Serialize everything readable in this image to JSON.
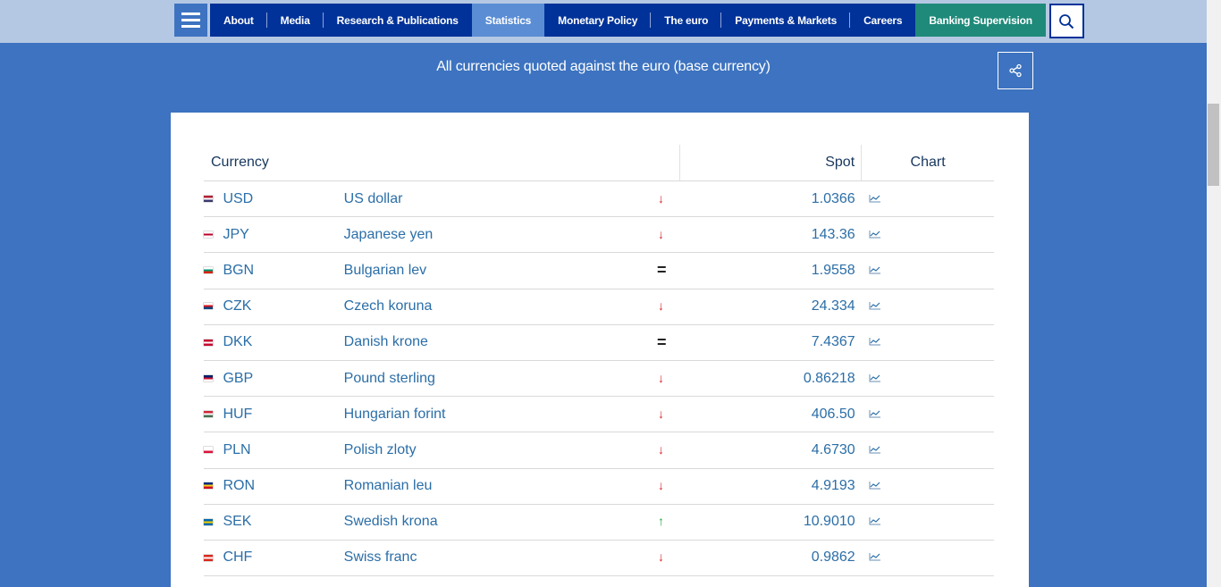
{
  "nav": {
    "items": [
      {
        "label": "About",
        "state": "normal"
      },
      {
        "label": "Media",
        "state": "normal"
      },
      {
        "label": "Research & Publications",
        "state": "normal"
      },
      {
        "label": "Statistics",
        "state": "active"
      },
      {
        "label": "Monetary Policy",
        "state": "normal"
      },
      {
        "label": "The euro",
        "state": "normal"
      },
      {
        "label": "Payments & Markets",
        "state": "normal"
      },
      {
        "label": "Careers",
        "state": "normal"
      },
      {
        "label": "Banking Supervision",
        "state": "highlight"
      }
    ]
  },
  "header": {
    "subtitle": "All currencies quoted against the euro (base currency)"
  },
  "table": {
    "columns": {
      "currency": "Currency",
      "spot": "Spot",
      "chart": "Chart"
    },
    "rows": [
      {
        "code": "USD",
        "name": "US dollar",
        "trend": "down",
        "spot": "1.0366",
        "flag": [
          "#b22234",
          "#ffffff",
          "#3c3b6e"
        ]
      },
      {
        "code": "JPY",
        "name": "Japanese yen",
        "trend": "down",
        "spot": "143.36",
        "flag": [
          "#ffffff",
          "#bc002d",
          "#ffffff"
        ]
      },
      {
        "code": "BGN",
        "name": "Bulgarian lev",
        "trend": "equal",
        "spot": "1.9558",
        "flag": [
          "#ffffff",
          "#00966e",
          "#d62612"
        ]
      },
      {
        "code": "CZK",
        "name": "Czech koruna",
        "trend": "down",
        "spot": "24.334",
        "flag": [
          "#ffffff",
          "#d7141a",
          "#11457e"
        ]
      },
      {
        "code": "DKK",
        "name": "Danish krone",
        "trend": "equal",
        "spot": "7.4367",
        "flag": [
          "#c60c30",
          "#ffffff",
          "#c60c30"
        ]
      },
      {
        "code": "GBP",
        "name": "Pound sterling",
        "trend": "down",
        "spot": "0.86218",
        "flag": [
          "#012169",
          "#c8102e",
          "#ffffff"
        ]
      },
      {
        "code": "HUF",
        "name": "Hungarian forint",
        "trend": "down",
        "spot": "406.50",
        "flag": [
          "#ce2939",
          "#ffffff",
          "#477050"
        ]
      },
      {
        "code": "PLN",
        "name": "Polish zloty",
        "trend": "down",
        "spot": "4.6730",
        "flag": [
          "#ffffff",
          "#ffffff",
          "#dc143c"
        ]
      },
      {
        "code": "RON",
        "name": "Romanian leu",
        "trend": "down",
        "spot": "4.9193",
        "flag": [
          "#002b7f",
          "#fcd116",
          "#ce1126"
        ]
      },
      {
        "code": "SEK",
        "name": "Swedish krona",
        "trend": "up",
        "spot": "10.9010",
        "flag": [
          "#006aa7",
          "#fecc00",
          "#006aa7"
        ]
      },
      {
        "code": "CHF",
        "name": "Swiss franc",
        "trend": "down",
        "spot": "0.9862",
        "flag": [
          "#da291c",
          "#ffffff",
          "#da291c"
        ]
      }
    ]
  },
  "icons": {
    "menu": "hamburger-menu-icon",
    "search": "search-icon",
    "share": "share-icon",
    "chart": "line-chart-icon"
  }
}
